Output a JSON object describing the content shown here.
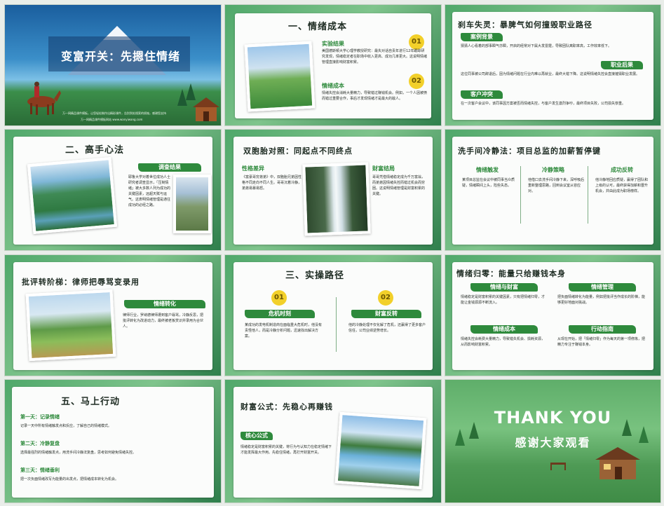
{
  "slides": {
    "s1": {
      "title": "变富开关：先摁住情绪",
      "caption1": "万一网精品课件模板，让您轻松制作出精彩课件，告别到处搜索的烦恼，感谢您支持",
      "caption2": "万一网精品课件模板网站 www.wanyiwang.com"
    },
    "s2": {
      "title": "一、情绪成本",
      "badge1": "01",
      "badge2": "02",
      "h1": "实验结果",
      "p1": "美国德斯顿大学心理学教授研究：最失对话自责年进行12年跟踪研究发现，情绪稳定者在职场中收入更高、成功几率更大。这说明情绪管理直接影响财富积累。",
      "h2": "情绪成本",
      "p2": "情绪失控会消耗大量精力，导致错过赚钱机会。例如，一个人因被愤而错过重要合作，事后才发现情绪才是最大的敌人。"
    },
    "s3": {
      "title": "刹车失灵：暴脾气如何撞毁职业路径",
      "h1": "案例背景",
      "p1": "猜猜人心看着的部事瞬气亦瞬，开启的经常对下属大发雷霆，导致团队离职率高，工作效率低下。",
      "h2": "职业后果",
      "p2": "这位同事被公司辞退后，因为情绪问题在行业内难以再就业，最终大错下降。这说明情绪失控会直接摧毁职业发展。",
      "h3": "客户冲突",
      "p3": "在一次客户会议中，该同事因方案被否而情绪失控，与客户发生激烈争吵，最终项目失败，公司损失惨重。"
    },
    "s4": {
      "title": "二、高手心法",
      "h1": "调查结果",
      "p1": "耶鲁大学对着世位成功人士研究者调查显示，「压制情绪」被大多数人列为成功的关键因素，远超天赋与运气。这表明情绪管理是通往成功的必经之路。"
    },
    "s5": {
      "title": "双胞胎对照：同起点不同终点",
      "h1": "性格差异",
      "p1": "《富豪哥穷弟弟》中，双胞胎兄弟因性格不同走向不同人生。哥哥沉着冷静，弟弟易暴易怒。",
      "h2": "财富结局",
      "p2": "哥哥凭借情绪稳定成为千万富翁，而弟弟因情绪失控而错过机会而穷困。这说明情绪管理是财富积累的关键。"
    },
    "s6": {
      "title": "洗手间冷静法：项目总监的加薪暂停键",
      "h1": "情绪触发",
      "p1": "某项目总监在会议中被同事当众质疑，情绪瞬间上头，险些失态。",
      "h2": "冷静策略",
      "p2": "他借口去洗手间冷静下来，深呼吸后重新整理思路，回到会议室从容应对。",
      "h3": "成功反转",
      "p3": "他冷静地回应质疑，赢得了团队和上级的认可，最终获得加薪和晋升机会，并由此成为职场榜样。"
    },
    "s7": {
      "title": "批评转阶梯：律师把辱骂变录用",
      "h1": "情绪转化",
      "p1": "律师行业，罗纳德律师遭到客户辱骂，冷静反思，把批评转化为改进动力，最终被老板赏识并录用为合伙人。"
    },
    "s8": {
      "title": "三、实操路径",
      "badge1": "01",
      "badge2": "02",
      "h1": "危机时刻",
      "p1": "某成功的发电机制造商在面临重大危机时，他没有责怪他人，而是冷静分析问题，迅速找出解决方案。",
      "h2": "财富反转",
      "p2": "他的冷静处理不仅化解了危机，还赢得了更多客户信任，公司业绩逆势增长。"
    },
    "s9": {
      "title": "情绪归零：能量只给赚钱本身",
      "h1": "情绪与财富",
      "p1": "情绪稳定是财富积累的关键因素，只有把情绪归零，才能让金钱源源不断流入。",
      "h2": "情绪管理",
      "p2": "把负面情绪转化为能量，例如把批评当作成长的阶梯，能够更好地面对挑战。",
      "h3": "情绪成本",
      "p3": "情绪失控会耗费大量精力，导致错失机会、损耗资源，从而影响财富积累。",
      "h4": "行动指南",
      "p4": "从现在开始，把「情绪归零」作为每天的第一项修炼，把精力专注于赚钱本身。"
    },
    "s10": {
      "title": "五、马上行动",
      "h1": "第一天：记录情绪",
      "p1": "记录一天中所有情绪触发点和反应，了解自己的情绪模式。",
      "h2": "第二天：冷静复盘",
      "p2": "选择最强烈的情绪触发点，用洗手间冷静法复盘，思考如何避免情绪失控。",
      "h3": "第三天：情绪垂利",
      "p3": "把一次负面情绪改写为能量的出发点，把情绪成本转化为机会。"
    },
    "s11": {
      "title": "财富公式：先稳心再赚钱",
      "h1": "核心公式",
      "p1": "情绪稳定是财富积累的关键，将行为与认知力在稳定情绪下才能发挥最大作用。先稳住情绪，再打开财富开关。"
    },
    "s12": {
      "en": "THANK YOU",
      "zh": "感谢大家观看"
    }
  },
  "colors": {
    "accent": "#2e8a3c",
    "badge": "#f2d02a",
    "dark_text": "#1d2b22"
  }
}
